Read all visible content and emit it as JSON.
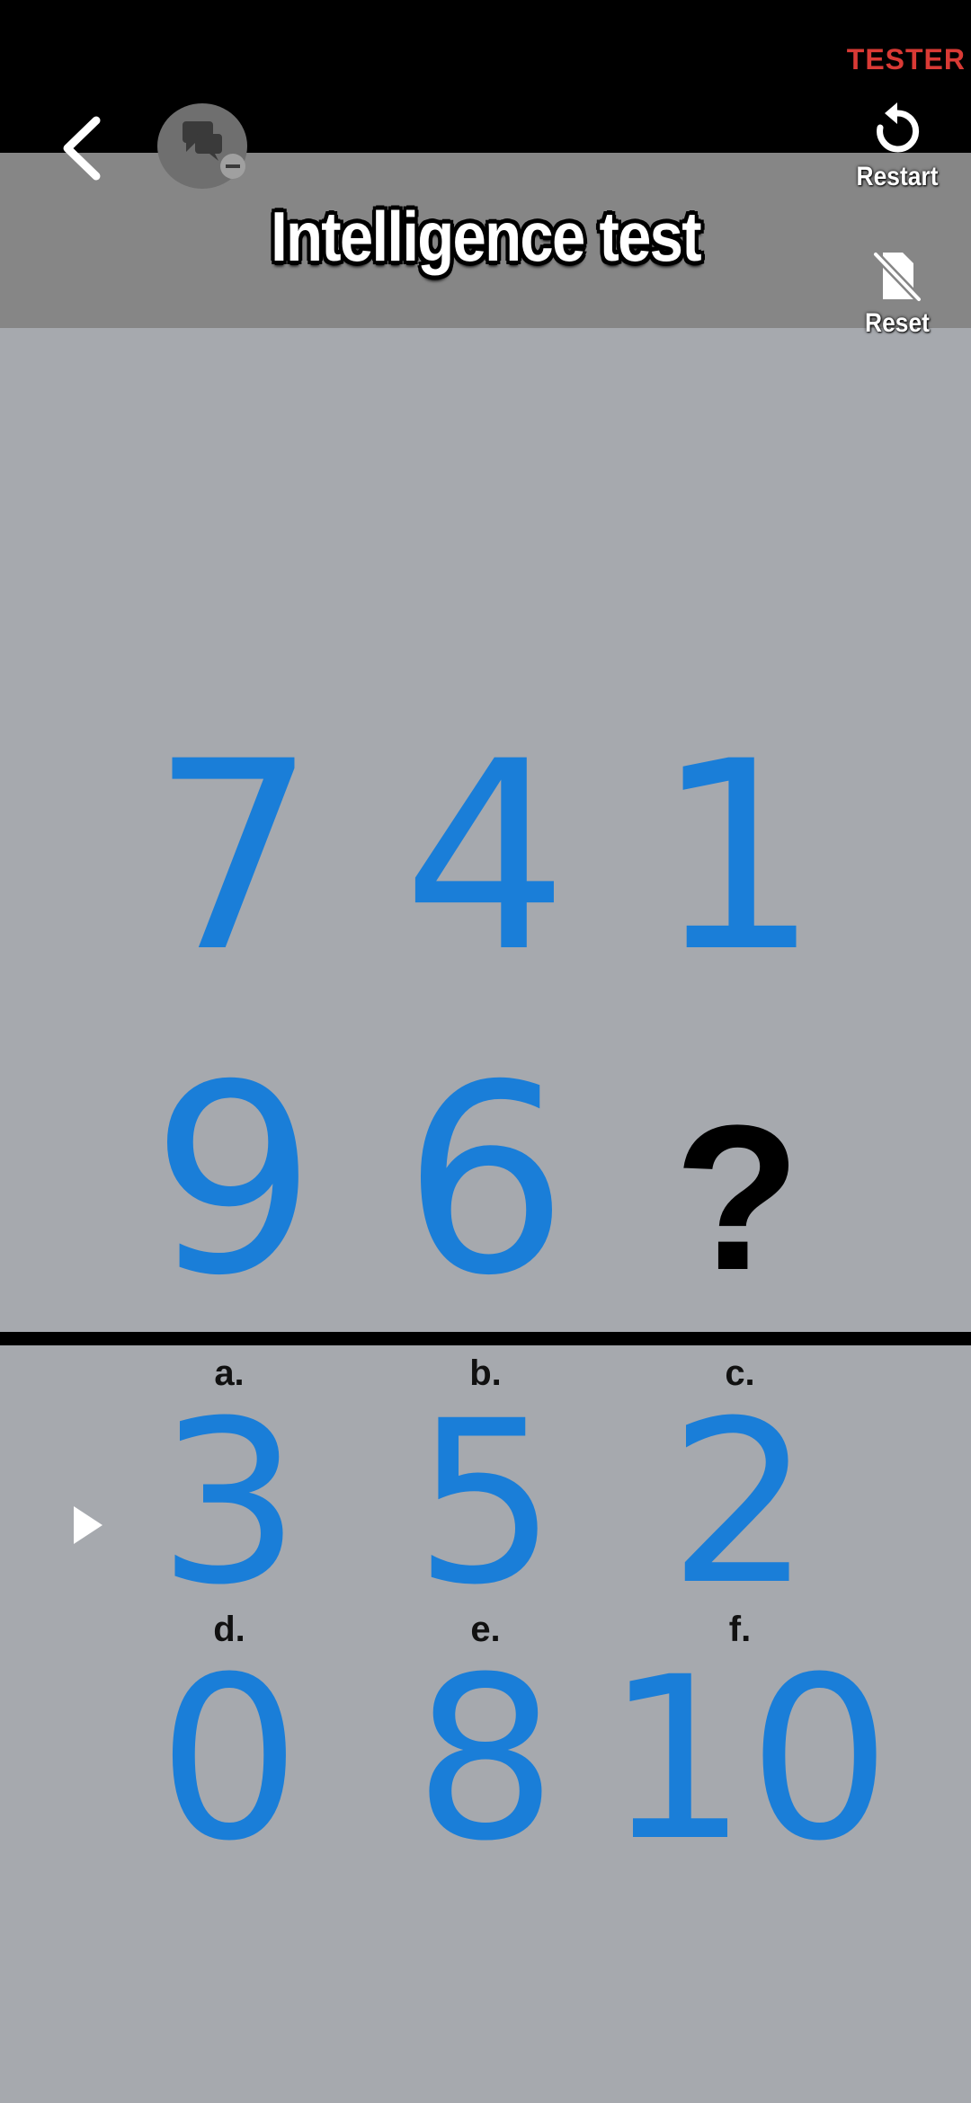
{
  "status_bar": {
    "badge": "TESTER"
  },
  "header": {
    "title": "Intelligence test",
    "back_icon": "chevron-left-icon",
    "chat_icon": "chat-remove-icon",
    "restart": {
      "label": "Restart",
      "icon": "restart-icon"
    },
    "reset": {
      "label": "Reset",
      "icon": "reset-icon"
    }
  },
  "puzzle": {
    "row1": [
      "7",
      "4",
      "1"
    ],
    "row2": [
      "9",
      "6",
      "?"
    ]
  },
  "options": [
    {
      "label": "a.",
      "value": "3"
    },
    {
      "label": "b.",
      "value": "5"
    },
    {
      "label": "c.",
      "value": "2"
    },
    {
      "label": "d.",
      "value": "0"
    },
    {
      "label": "e.",
      "value": "8"
    },
    {
      "label": "f.",
      "value": "10"
    }
  ],
  "colors": {
    "accent": "#1a7ed8",
    "background": "#a6a9ae",
    "header_band": "#868686",
    "tester": "#d93a35"
  }
}
